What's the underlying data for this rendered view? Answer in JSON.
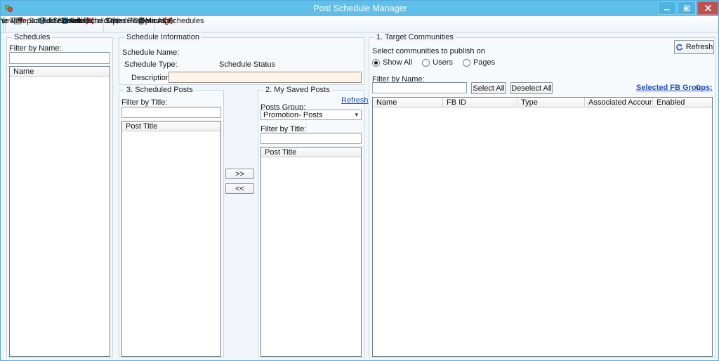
{
  "window": {
    "title": "Post Schedule Manager",
    "icon": "app-logo-icon",
    "minimize_label": "–",
    "maximize_label": "❐",
    "close_label": "✕"
  },
  "toolbar": {
    "items": [
      {
        "label": "New One Time Schedule",
        "icon": "calendar-new-icon"
      },
      {
        "label": "New Repeated Schedule",
        "icon": "repeat-cycle-icon"
      },
      {
        "label": "Edit Schedule",
        "icon": "edit-document-icon"
      },
      {
        "label": "Delete Schedule",
        "icon": "red-x-icon"
      },
      {
        "label": "Additional Schedule Options",
        "icon": "gear-icon"
      },
      {
        "label": "Open Post Manager",
        "icon": "clipboard-icon"
      },
      {
        "label": "Delete All Schedules",
        "icon": "red-x-icon"
      }
    ]
  },
  "schedules_panel": {
    "caption": "Schedules",
    "filter_label": "Filter by Name:",
    "filter_value": "",
    "filter_placeholder": "",
    "list_header": "Name",
    "rows": []
  },
  "schedule_information": {
    "caption": "Schedule Information",
    "name_label": "Schedule Name:",
    "name_value": "-",
    "type_label": "Schedule Type:",
    "type_value": "-",
    "status_label": "Schedule Status",
    "status_value": "-",
    "description_label": "Description:",
    "description_value": "",
    "description_placeholder": ""
  },
  "scheduled_posts": {
    "caption": "3. Scheduled Posts",
    "filter_label": "Filter by Title:",
    "filter_value": "",
    "filter_placeholder": "",
    "list_header": "Post Title",
    "rows": []
  },
  "transfer": {
    "add_label": ">>",
    "remove_label": "<<"
  },
  "saved_posts": {
    "caption": "2. My Saved Posts",
    "refresh_label": "Refresh",
    "group_label": "Posts Group:",
    "group_value": "Promotion- Posts",
    "group_options": [
      "Promotion- Posts"
    ],
    "filter_label": "Filter by Title:",
    "filter_value": "",
    "filter_placeholder": "",
    "list_header": "Post Title",
    "rows": []
  },
  "target_communities": {
    "caption": "1. Target Communities",
    "subtitle": "Select communities to publish on",
    "refresh_label": "Refresh",
    "refresh_icon": "refresh-icon",
    "radios": [
      {
        "label": "Show All",
        "selected": true
      },
      {
        "label": "Users",
        "selected": false
      },
      {
        "label": "Pages",
        "selected": false
      }
    ],
    "filter_label": "Filter by Name:",
    "filter_value": "",
    "filter_placeholder": "",
    "select_all_label": "Select All",
    "deselect_all_label": "Deselect All",
    "selected_link_label": "Selected FB Groups:",
    "selected_count": "0",
    "columns": [
      "Name",
      "FB ID",
      "Type",
      "Associated Account",
      "Enabled"
    ],
    "rows": []
  },
  "colors": {
    "titlebar": "#5ec0ea",
    "close_button": "#c0504d",
    "link": "#1a4fd0",
    "accent_icon": "#2e9bd6",
    "danger": "#e8382c",
    "description_field": "#fdf3e7"
  }
}
